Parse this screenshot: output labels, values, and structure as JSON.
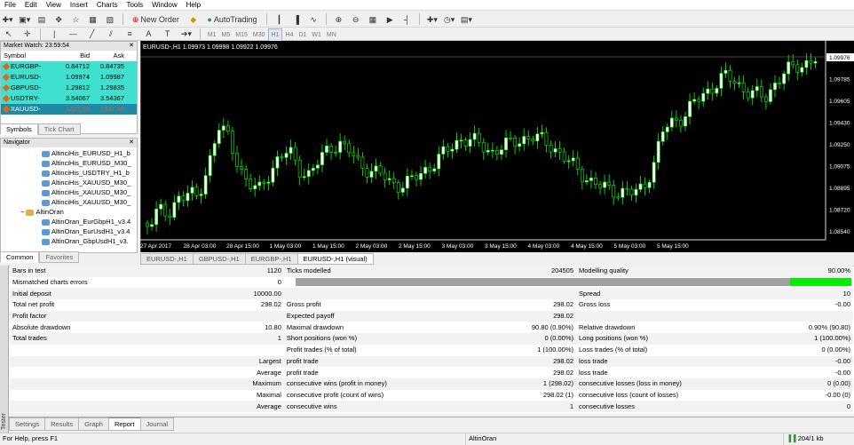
{
  "menu": [
    "File",
    "Edit",
    "View",
    "Insert",
    "Charts",
    "Tools",
    "Window",
    "Help"
  ],
  "toolbar": {
    "new_order": "New Order",
    "autotrading": "AutoTrading"
  },
  "timeframes": [
    "M1",
    "M5",
    "M15",
    "M30",
    "H1",
    "H4",
    "D1",
    "W1",
    "MN"
  ],
  "market_watch": {
    "title": "Market Watch: 23:59:54",
    "headers": {
      "symbol": "Symbol",
      "bid": "Bid",
      "ask": "Ask"
    },
    "rows": [
      {
        "symbol": "EURGBP-",
        "bid": "0.84712",
        "ask": "0.84735"
      },
      {
        "symbol": "EURUSD-",
        "bid": "1.09974",
        "ask": "1.09987"
      },
      {
        "symbol": "GBPUSD-",
        "bid": "1.29812",
        "ask": "1.29835"
      },
      {
        "symbol": "USDTRY-",
        "bid": "3.54067",
        "ask": "3.54367"
      },
      {
        "symbol": "XAUUSD-",
        "bid": "1227.09",
        "ask": "1227.45"
      }
    ],
    "tabs": [
      "Symbols",
      "Tick Chart"
    ]
  },
  "navigator": {
    "title": "Navigator",
    "items": [
      "AltinciHis_EURUSD_H1_b",
      "AltinciHis_EURUSD_M30_",
      "AltinciHis_USDTRY_H1_b",
      "AltinciHis_XAUUSD_M30_",
      "AltinciHis_XAUUSD_M30_",
      "AltinciHis_XAUUSD_M30_"
    ],
    "folder": "AltinOran",
    "subitems": [
      "AltinOran_EurGbpH1_v3.4",
      "AltinOran_EurUsdH1_v3.4",
      "AltinOran_GbpUsdH1_v3."
    ],
    "tabs": [
      "Common",
      "Favorites"
    ]
  },
  "chart": {
    "header": "EURUSD-,H1  1.09973 1.09998 1.09922 1.09976",
    "price_labels": [
      "1.09976",
      "1.09785",
      "1.09605",
      "1.09430",
      "1.09250",
      "1.09075",
      "1.08895",
      "1.08720",
      "1.08540"
    ],
    "time_labels": [
      "27 Apr 2017",
      "28 Apr 03:00",
      "28 Apr 15:00",
      "1 May 03:00",
      "1 May 15:00",
      "2 May 03:00",
      "2 May 15:00",
      "3 May 03:00",
      "3 May 15:00",
      "4 May 03:00",
      "4 May 15:00",
      "5 May 03:00",
      "5 May 15:00"
    ],
    "tabs": [
      "EURUSD-,H1",
      "GBPUSD-,H1",
      "EURGBP-,H1",
      "EURUSD-,H1 (visual)"
    ],
    "colors": {
      "bull": "#00ff00",
      "bear": "#00ff00",
      "bg": "#000000"
    }
  },
  "report": {
    "rows": [
      [
        "Bars in test",
        "1120",
        "Ticks modelled",
        "204505",
        "Modelling quality",
        "90.00%"
      ],
      [
        "Mismatched charts errors",
        "0",
        "",
        "",
        "",
        ""
      ],
      [
        "Initial deposit",
        "10000.00",
        "",
        "",
        "Spread",
        "10"
      ],
      [
        "Total net profit",
        "298.02",
        "Gross profit",
        "298.02",
        "Gross loss",
        "-0.00"
      ],
      [
        "Profit factor",
        "",
        "Expected payoff",
        "298.02",
        "",
        ""
      ],
      [
        "Absolute drawdown",
        "10.80",
        "Maximal drawdown",
        "90.80 (0.90%)",
        "Relative drawdown",
        "0.90% (90.80)"
      ],
      [
        "Total trades",
        "1",
        "Short positions (won %)",
        "0 (0.00%)",
        "Long positions (won %)",
        "1 (100.00%)"
      ],
      [
        "",
        "",
        "Profit trades (% of total)",
        "1 (100.00%)",
        "Loss trades (% of total)",
        "0 (0.00%)"
      ],
      [
        "",
        "Largest",
        "profit trade",
        "298.02",
        "loss trade",
        "-0.00"
      ],
      [
        "",
        "Average",
        "profit trade",
        "298.02",
        "loss trade",
        "-0.00"
      ],
      [
        "",
        "Maximum",
        "consecutive wins (profit in money)",
        "1 (298.02)",
        "consecutive losses (loss in money)",
        "0 (0.00)"
      ],
      [
        "",
        "Maximal",
        "consecutive profit (count of wins)",
        "298.02 (1)",
        "consecutive loss (count of losses)",
        "-0.00 (0)"
      ],
      [
        "",
        "Average",
        "consecutive wins",
        "1",
        "consecutive losses",
        "0"
      ]
    ],
    "modelling_quality_fraction": 0.9
  },
  "tester_label": "Tester",
  "tester_tabs": [
    "Settings",
    "Results",
    "Graph",
    "Report",
    "Journal"
  ],
  "status": {
    "help": "For Help, press F1",
    "profile": "AltinOran",
    "traffic": "204/1 kb"
  }
}
